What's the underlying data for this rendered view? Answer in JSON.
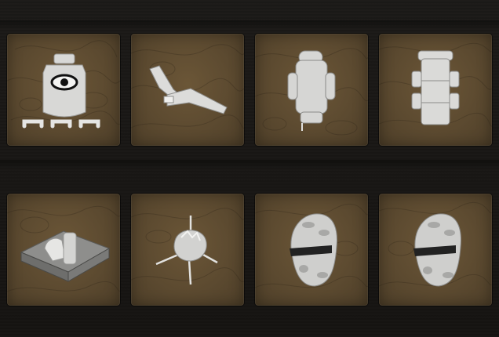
{
  "inventory": {
    "slots": [
      {
        "icon": "armor-vest-eye-icon"
      },
      {
        "icon": "glider-wing-icon"
      },
      {
        "icon": "backpack-rolled-icon"
      },
      {
        "icon": "backpack-frame-icon"
      },
      {
        "icon": "supply-crate-icon"
      },
      {
        "icon": "campfire-spit-icon"
      },
      {
        "icon": "camo-balaclava-icon"
      },
      {
        "icon": "camo-balaclava-icon"
      }
    ]
  },
  "colors": {
    "background": "#171513",
    "slot": "#5c4a30",
    "item": "#d8d8d6"
  }
}
